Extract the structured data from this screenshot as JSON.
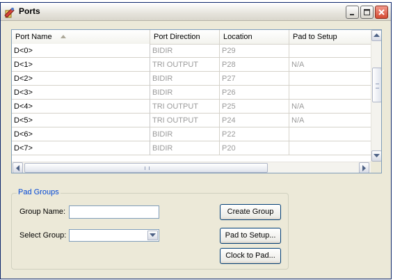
{
  "background_text": "",
  "window": {
    "title": "Ports"
  },
  "grid": {
    "columns": [
      "Port Name",
      "Port Direction",
      "Location",
      "Pad to Setup"
    ],
    "rows": [
      {
        "name": "D<0>",
        "direction": "BIDIR",
        "location": "P29",
        "pad": ""
      },
      {
        "name": "D<1>",
        "direction": "TRI OUTPUT",
        "location": "P28",
        "pad": "N/A"
      },
      {
        "name": "D<2>",
        "direction": "BIDIR",
        "location": "P27",
        "pad": ""
      },
      {
        "name": "D<3>",
        "direction": "BIDIR",
        "location": "P26",
        "pad": ""
      },
      {
        "name": "D<4>",
        "direction": "TRI OUTPUT",
        "location": "P25",
        "pad": "N/A"
      },
      {
        "name": "D<5>",
        "direction": "TRI OUTPUT",
        "location": "P24",
        "pad": "N/A"
      },
      {
        "name": "D<6>",
        "direction": "BIDIR",
        "location": "P22",
        "pad": ""
      },
      {
        "name": "D<7>",
        "direction": "BIDIR",
        "location": "P20",
        "pad": ""
      }
    ]
  },
  "pad_groups": {
    "legend": "Pad Groups",
    "group_name_label": "Group Name:",
    "group_name_value": "",
    "select_group_label": "Select Group:",
    "select_group_value": "",
    "create_button": "Create Group",
    "pad_to_setup_button": "Pad to Setup...",
    "clock_to_pad_button": "Clock to Pad..."
  },
  "colors": {
    "title_bar": "#ece9d8",
    "legend_text": "#0046d5",
    "inactive_text": "#9a9a9a"
  }
}
